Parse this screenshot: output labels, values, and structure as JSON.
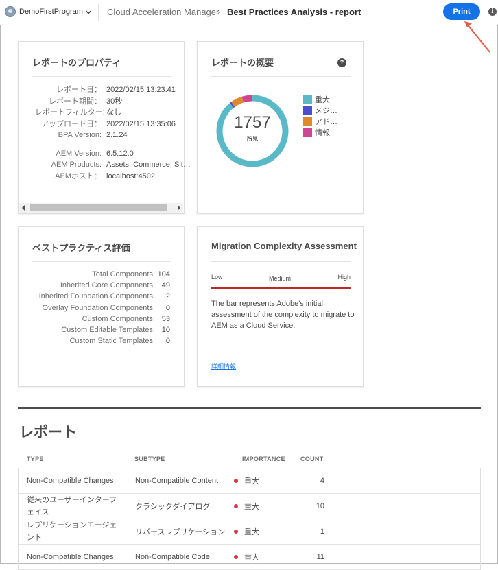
{
  "header": {
    "program_name": "DemoFirstProgram",
    "breadcrumb_root": "Cloud Acceleration Manager",
    "breadcrumb_separator": "›",
    "breadcrumb_current": "Best Practices Analysis - report",
    "print_label": "Print",
    "info_icon": "i"
  },
  "report_properties": {
    "title": "レポートのプロパティ",
    "rows": [
      {
        "label": "レポート日：",
        "value": "2022/02/15 13:23:41"
      },
      {
        "label": "レポート期間：",
        "value": "30秒"
      },
      {
        "label": "レポートフィルター:",
        "value": "なし"
      },
      {
        "label": "アップロード日：",
        "value": "2022/02/15 13:35:06"
      },
      {
        "label": "BPA Version:",
        "value": "2.1.24"
      }
    ],
    "rows2": [
      {
        "label": "AEM Version:",
        "value": "6.5.12.0"
      },
      {
        "label": "AEM Products:",
        "value": "Assets, Commerce, Sit…"
      },
      {
        "label": "AEMホスト：",
        "value": "localhost:4502"
      }
    ]
  },
  "report_overview": {
    "title": "レポートの概要",
    "help_icon": "?",
    "total": "1757",
    "total_caption": "所見",
    "legend": [
      {
        "label": "重大",
        "color": "#5ab9c6",
        "value": 1567
      },
      {
        "label": "メジ…",
        "color": "#4a4ed1",
        "value": 14
      },
      {
        "label": "アド…",
        "color": "#de8a2c",
        "value": 91
      },
      {
        "label": "情報",
        "color": "#cf4592",
        "value": 85
      }
    ]
  },
  "best_practices": {
    "title": "ベストプラクティス評価",
    "rows": [
      {
        "label": "Total Components:",
        "value": "104"
      },
      {
        "label": "Inherited Core Components:",
        "value": "49"
      },
      {
        "label": "Inherited Foundation Components:",
        "value": "2"
      },
      {
        "label": "Overlay Foundation Components:",
        "value": "0"
      },
      {
        "label": "Custom Components:",
        "value": "53"
      },
      {
        "label": "Custom Editable Templates:",
        "value": "10"
      },
      {
        "label": "Custom Static Templates:",
        "value": "0"
      }
    ]
  },
  "migration": {
    "title": "Migration Complexity Assessment",
    "low": "Low",
    "medium": "Medium",
    "high": "High",
    "description": "The bar represents Adobe's initial assessment of the complexity to migrate to AEM as a Cloud Service.",
    "link": "詳細情報",
    "bar_color": "#b52b2b"
  },
  "report": {
    "title": "レポート",
    "columns": {
      "type": "TYPE",
      "subtype": "SUBTYPE",
      "importance": "IMPORTANCE",
      "count": "COUNT"
    },
    "rows": [
      {
        "type": "Non-Compatible Changes",
        "subtype": "Non-Compatible Content",
        "importance": "重大",
        "count": "4"
      },
      {
        "type": "従来のユーザーインターフェイス",
        "subtype": "クラシックダイアログ",
        "importance": "重大",
        "count": "10"
      },
      {
        "type": "レプリケーションエージェント",
        "subtype": "リバースレプリケーション",
        "importance": "重大",
        "count": "1"
      },
      {
        "type": "Non-Compatible Changes",
        "subtype": "Non-Compatible Code",
        "importance": "重大",
        "count": "11"
      }
    ]
  }
}
